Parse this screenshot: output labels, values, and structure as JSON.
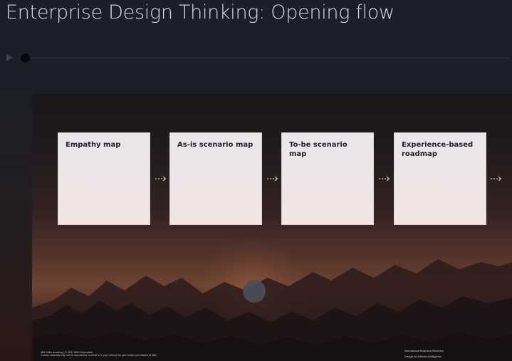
{
  "header": {
    "title": "Enterprise Design Thinking: Opening flow"
  },
  "player": {
    "play_icon": "play-icon",
    "progress": 0
  },
  "slide": {
    "cards": [
      {
        "label": "Empathy map"
      },
      {
        "label": "As-is scenario map"
      },
      {
        "label": "To-be scenario map"
      },
      {
        "label": "Experience-based roadmap"
      }
    ],
    "arrow_icon": "dashed-arrow-right-icon",
    "footer_left": {
      "line1": "IBM Skills Academy | © 2021 IBM Corporation.",
      "line2": "Course materials may not be reproduced in whole or in part without the prior written permission of IBM."
    },
    "footer_right": {
      "line1": "International Business Machines",
      "line2": "Design for Artificial Intelligence"
    }
  },
  "colors": {
    "background": "#1c1f2a",
    "card": "#efe6e8",
    "card_text": "#20222a"
  }
}
